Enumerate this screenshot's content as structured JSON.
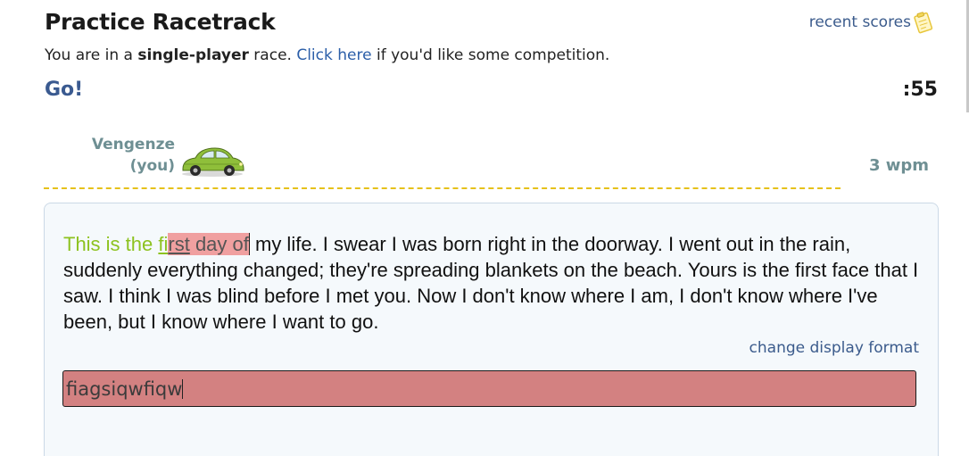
{
  "header": {
    "title": "Practice Racetrack",
    "recent_scores": "recent scores",
    "clipboard_icon": "clipboard-icon"
  },
  "subline": {
    "prefix": "You are in a ",
    "mode": "single-player",
    "middle": " race. ",
    "link": "Click here",
    "suffix": " if you'd like some competition."
  },
  "race": {
    "status": "Go!",
    "timer": ":55"
  },
  "player": {
    "name": "Vengenze",
    "tag": "(you)",
    "car_icon": "green-beetle-car-icon",
    "wpm": "3 wpm",
    "progress_percent": 0
  },
  "passage": {
    "correct_typed": "This is the ",
    "partial_correct": "fi",
    "error_in_word": "rst",
    "error_rest": " day of",
    "remaining": " my life. I swear I was born right in the doorway. I went out in the rain, suddenly everything changed; they're spreading blankets on the beach. Yours is the first face that I saw. I think I was blind before I met you. Now I don't know where I am, I don't know where I've been, but I know where I want to go."
  },
  "controls": {
    "change_display_format": "change display format"
  },
  "input": {
    "value": "fiagsiqwfiqw"
  },
  "colors": {
    "link": "#2b5ea8",
    "correct_text": "#8dc21f",
    "error_highlight": "#f0a0a0",
    "input_error_bg": "#d38181",
    "track_line": "#e6c11a"
  }
}
